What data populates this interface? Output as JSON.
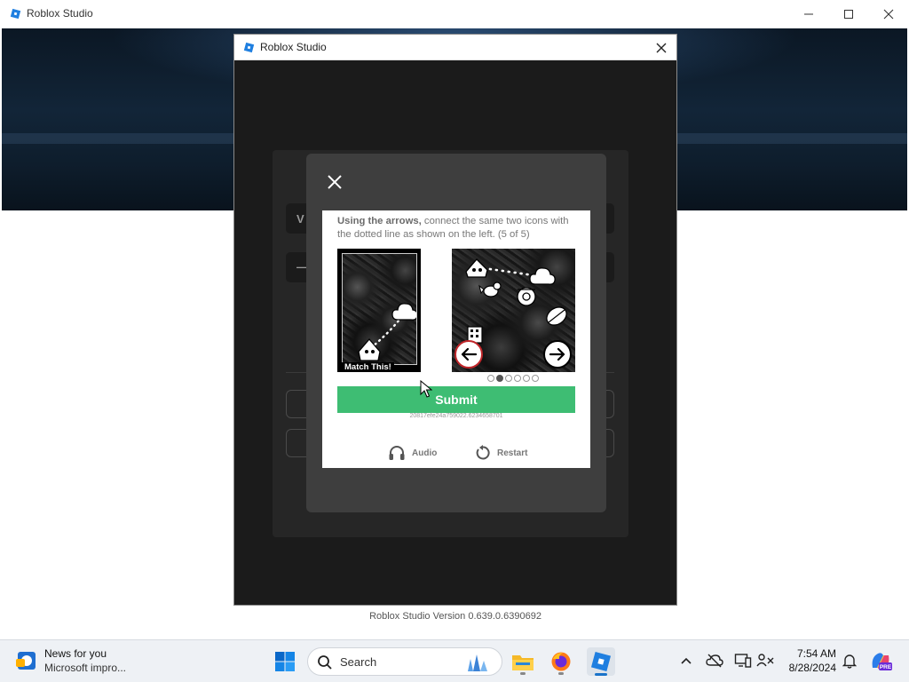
{
  "outer_window": {
    "title": "Roblox Studio",
    "minimize_glyph": "—",
    "maximize_glyph": "☐",
    "close_glyph": "✕",
    "version_text": "Roblox Studio Version 0.639.0.6390692"
  },
  "login_dialog": {
    "title": "Roblox Studio",
    "background_peek": [
      "V",
      "—"
    ]
  },
  "captcha": {
    "instruction_bold": "Using the arrows,",
    "instruction_rest": " connect the same two icons with the dotted line as shown on the left. (5 of 5)",
    "reference_label": "Match This!",
    "progress": {
      "current": 2,
      "total": 6
    },
    "submit_label": "Submit",
    "session_id": "20817efe24a759022.6234658701",
    "audio_label": "Audio",
    "restart_label": "Restart",
    "colors": {
      "submit": "#3ebd73",
      "modal": "#3e3e3e",
      "arrow_border": "#c0262a"
    }
  },
  "taskbar": {
    "news_title": "News for you",
    "news_subtitle": "Microsoft impro...",
    "search_label": "Search",
    "apps": [
      "windows-start",
      "file-explorer",
      "firefox",
      "roblox-studio"
    ],
    "tray_icons": [
      "chevron-up",
      "onedrive-offline",
      "devices",
      "accessibility",
      "volume"
    ],
    "clock_time": "7:54 AM",
    "clock_date": "8/28/2024",
    "copilot_badge": "PRE"
  }
}
